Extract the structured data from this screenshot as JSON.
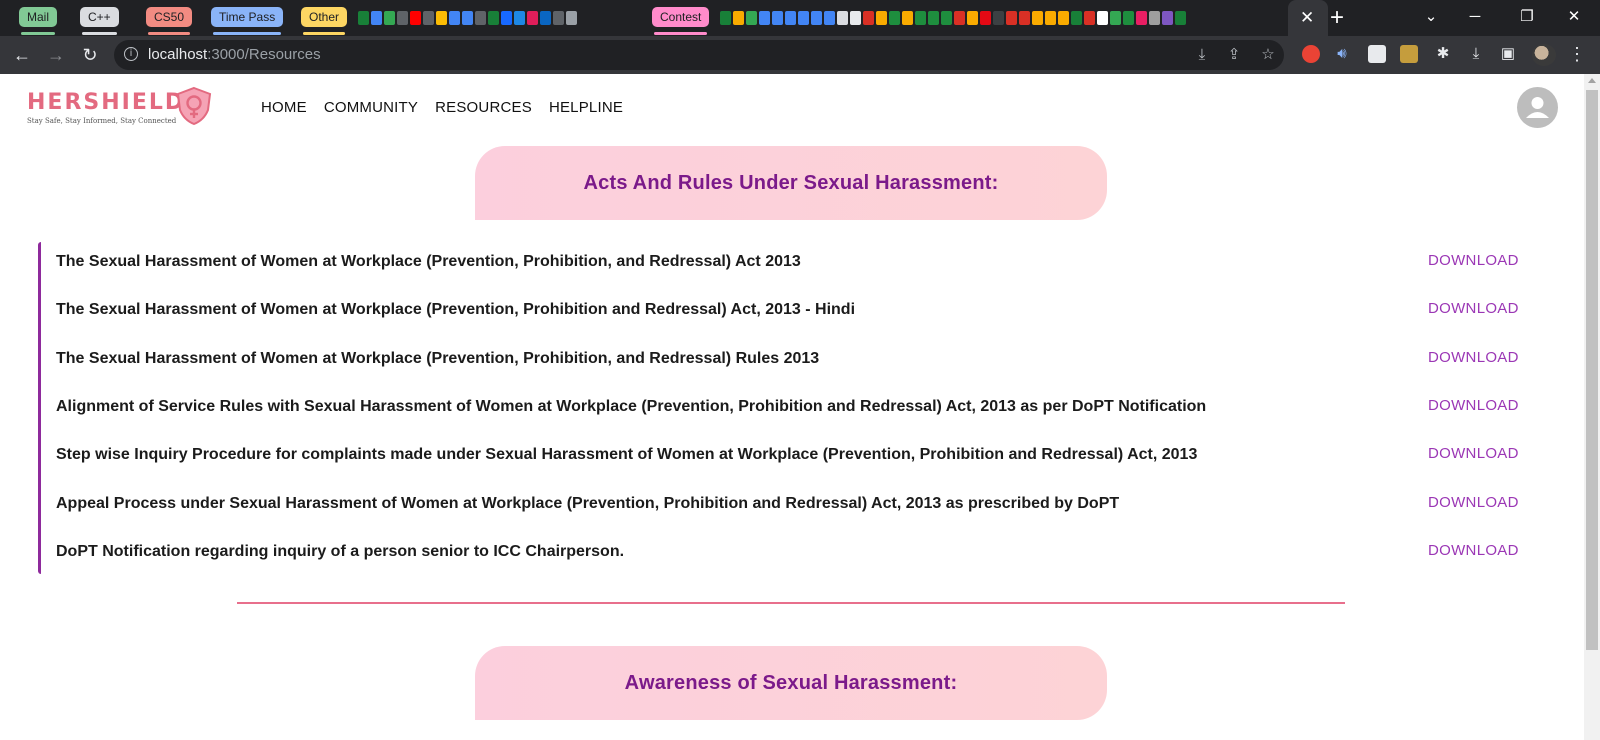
{
  "browser": {
    "tab_groups": [
      {
        "label": "Mail",
        "color": "#81c995"
      },
      {
        "label": "C++",
        "color": "#dadce0"
      },
      {
        "label": "CS50",
        "color": "#f28b82"
      },
      {
        "label": "Time Pass",
        "color": "#8ab4f8"
      },
      {
        "label": "Other",
        "color": "#fdd663"
      },
      {
        "label": "Contest",
        "color": "#ff8bcb"
      }
    ],
    "active_tab_close_icon": "close-icon",
    "new_tab_icon": "plus-icon",
    "window_controls": [
      "chevron-down-icon",
      "minimize-icon",
      "restore-icon",
      "close-icon"
    ],
    "url_host": "localhost",
    "url_path": ":3000/Resources"
  },
  "app": {
    "logo_text": "HERSHIELD",
    "logo_tagline": "Stay Safe, Stay Informed, Stay Connected",
    "nav": [
      "HOME",
      "COMMUNITY",
      "RESOURCES",
      "HELPLINE"
    ],
    "avatar_icon": "person-icon"
  },
  "sections": [
    {
      "heading": "Acts And Rules Under Sexual Harassment:"
    },
    {
      "heading": "Awareness of Sexual Harassment:"
    }
  ],
  "resources": [
    {
      "title": "The Sexual Harassment of Women at Workplace (Prevention, Prohibition, and Redressal) Act 2013",
      "action": "DOWNLOAD"
    },
    {
      "title": "The Sexual Harassment of Women at Workplace (Prevention, Prohibition and Redressal) Act, 2013 - Hindi",
      "action": "DOWNLOAD"
    },
    {
      "title": "The Sexual Harassment of Women at Workplace (Prevention, Prohibition, and Redressal) Rules 2013",
      "action": "DOWNLOAD"
    },
    {
      "title": "Alignment of Service Rules with Sexual Harassment of Women at Workplace (Prevention, Prohibition and Redressal) Act, 2013 as per DoPT Notification",
      "action": "DOWNLOAD"
    },
    {
      "title": "Step wise Inquiry Procedure for complaints made under Sexual Harassment of Women at Workplace (Prevention, Prohibition and Redressal) Act, 2013",
      "action": "DOWNLOAD"
    },
    {
      "title": "Appeal Process under Sexual Harassment of Women at Workplace (Prevention, Prohibition and Redressal) Act, 2013 as prescribed by DoPT",
      "action": "DOWNLOAD"
    },
    {
      "title": "DoPT Notification regarding inquiry of a person senior to ICC Chairperson.",
      "action": "DOWNLOAD"
    }
  ],
  "colors": {
    "accent_purple": "#7b1a8a",
    "download_purple": "#9b37b5",
    "logo_pink": "#e36a80",
    "divider_pink": "#e86f8c",
    "banner_pink": "#fccfdd"
  }
}
